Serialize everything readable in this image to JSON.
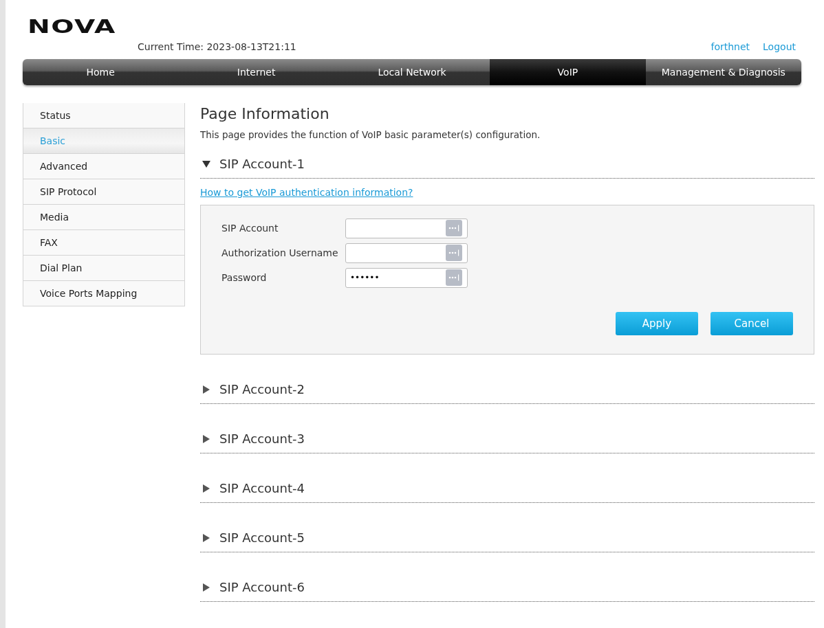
{
  "logo": "NOVA",
  "current_time": "Current Time: 2023-08-13T21:11",
  "user_links": [
    "forthnet",
    "Logout"
  ],
  "nav_tabs": [
    {
      "label": "Home",
      "selected": false
    },
    {
      "label": "Internet",
      "selected": false
    },
    {
      "label": "Local Network",
      "selected": false
    },
    {
      "label": "VoIP",
      "selected": true
    },
    {
      "label": "Management & Diagnosis",
      "selected": false
    }
  ],
  "sidebar": {
    "items": [
      {
        "label": "Status",
        "selected": false
      },
      {
        "label": "Basic",
        "selected": true
      },
      {
        "label": "Advanced",
        "selected": false
      },
      {
        "label": "SIP Protocol",
        "selected": false
      },
      {
        "label": "Media",
        "selected": false
      },
      {
        "label": "FAX",
        "selected": false
      },
      {
        "label": "Dial Plan",
        "selected": false
      },
      {
        "label": "Voice Ports Mapping",
        "selected": false
      }
    ]
  },
  "page_title": "Page Information",
  "page_description": "This page provides the function of VoIP basic parameter(s) configuration.",
  "sections": [
    {
      "title": "SIP Account-1",
      "expanded": true,
      "help_link": "How to get VoIP authentication information?",
      "fields": [
        {
          "label": "SIP Account"
        },
        {
          "label": "Authorization Username"
        },
        {
          "label": "Password",
          "value": "••••••"
        }
      ],
      "buttons": [
        "Apply",
        "Cancel"
      ]
    },
    {
      "title": "SIP Account-2",
      "expanded": false
    },
    {
      "title": "SIP Account-3",
      "expanded": false
    },
    {
      "title": "SIP Account-4",
      "expanded": false
    },
    {
      "title": "SIP Account-5",
      "expanded": false
    },
    {
      "title": "SIP Account-6",
      "expanded": false
    }
  ]
}
